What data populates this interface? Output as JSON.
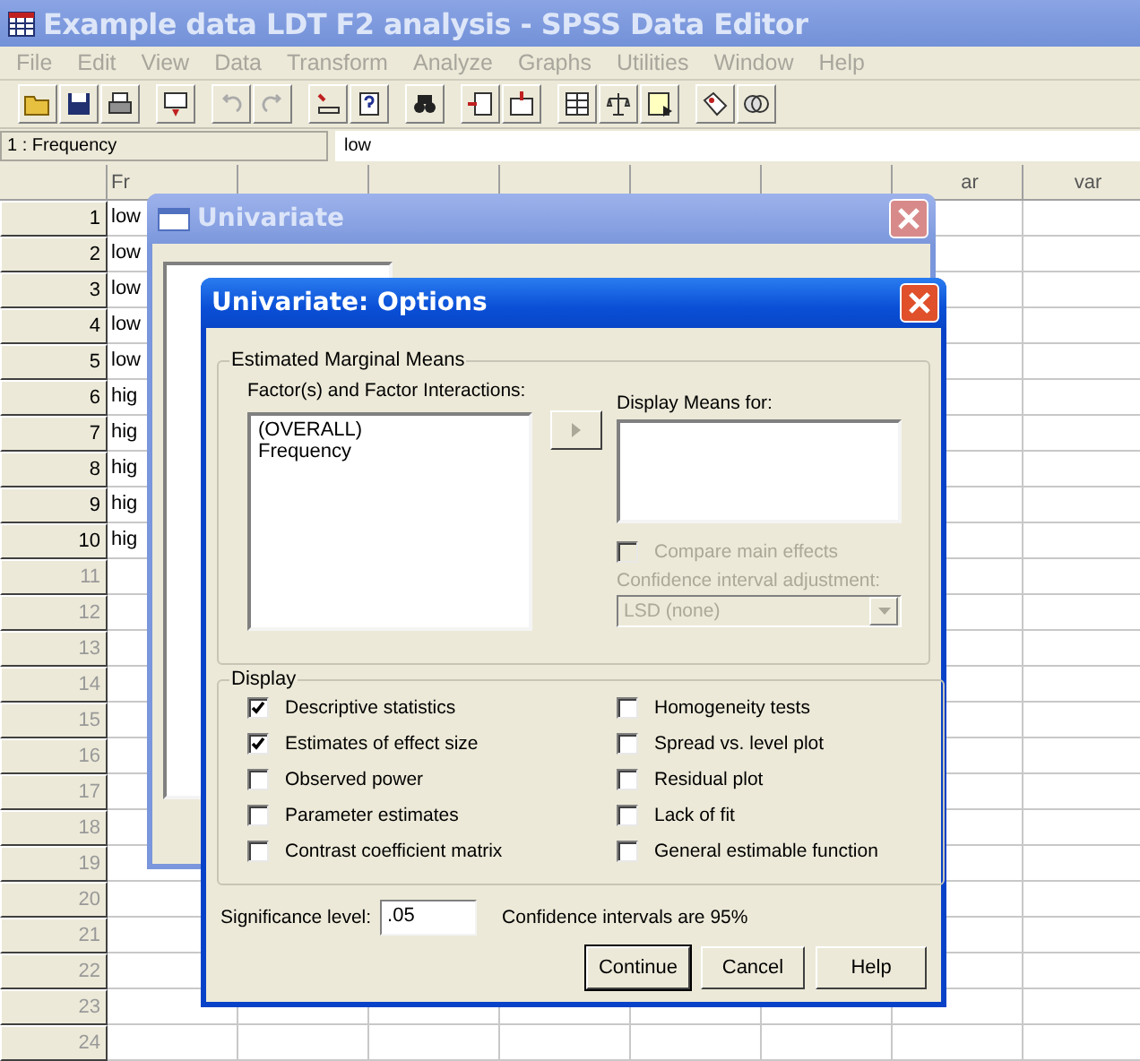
{
  "window": {
    "title": "Example data LDT F2 analysis - SPSS Data Editor",
    "active": false
  },
  "menu": [
    "File",
    "Edit",
    "View",
    "Data",
    "Transform",
    "Analyze",
    "Graphs",
    "Utilities",
    "Window",
    "Help"
  ],
  "cell_editor": {
    "reference": "1 : Frequency",
    "value": "low"
  },
  "grid": {
    "columns": [
      "Fr",
      "ar",
      "var"
    ],
    "rows": [
      {
        "number": "1",
        "value": "low"
      },
      {
        "number": "2",
        "value": "low"
      },
      {
        "number": "3",
        "value": "low"
      },
      {
        "number": "4",
        "value": "low"
      },
      {
        "number": "5",
        "value": "low"
      },
      {
        "number": "6",
        "value": "hig"
      },
      {
        "number": "7",
        "value": "hig"
      },
      {
        "number": "8",
        "value": "hig"
      },
      {
        "number": "9",
        "value": "hig"
      },
      {
        "number": "10",
        "value": "hig"
      },
      {
        "number": "11"
      },
      {
        "number": "12"
      },
      {
        "number": "13"
      },
      {
        "number": "14"
      },
      {
        "number": "15"
      },
      {
        "number": "16"
      },
      {
        "number": "17"
      },
      {
        "number": "18"
      },
      {
        "number": "19"
      },
      {
        "number": "20"
      },
      {
        "number": "21"
      },
      {
        "number": "22"
      },
      {
        "number": "23"
      },
      {
        "number": "24"
      }
    ]
  },
  "univariate_dialog": {
    "title": "Univariate",
    "active": false
  },
  "options_dialog": {
    "title": "Univariate: Options",
    "active": true,
    "marginal_means": {
      "legend": "Estimated Marginal Means",
      "factors_label": "Factor(s) and Factor Interactions:",
      "factors": [
        "(OVERALL)",
        "Frequency"
      ],
      "move_button": {
        "disabled": true
      },
      "display_label": "Display Means for:",
      "compare": {
        "label": "Compare main effects",
        "checked": false,
        "disabled": true
      },
      "adjustment": {
        "label": "Confidence interval adjustment:",
        "value": "LSD (none)",
        "disabled": true
      }
    },
    "display": {
      "legend": "Display",
      "options": [
        {
          "label": "Descriptive statistics",
          "checked": true
        },
        {
          "label": "Estimates of effect size",
          "checked": true
        },
        {
          "label": "Observed power",
          "checked": false
        },
        {
          "label": "Parameter estimates",
          "checked": false
        },
        {
          "label": "Contrast coefficient matrix",
          "checked": false
        },
        {
          "label": "Homogeneity tests",
          "checked": false
        },
        {
          "label": "Spread vs. level plot",
          "checked": false
        },
        {
          "label": "Residual plot",
          "checked": false
        },
        {
          "label": "Lack of fit",
          "checked": false
        },
        {
          "label": "General estimable function",
          "checked": false
        }
      ]
    },
    "significance": {
      "label": "Significance level:",
      "value": ".05"
    },
    "confidence_note": "Confidence intervals are 95%",
    "buttons": [
      {
        "label": "Continue",
        "default": true
      },
      {
        "label": "Cancel",
        "default": false
      },
      {
        "label": "Help",
        "default": false
      }
    ]
  }
}
